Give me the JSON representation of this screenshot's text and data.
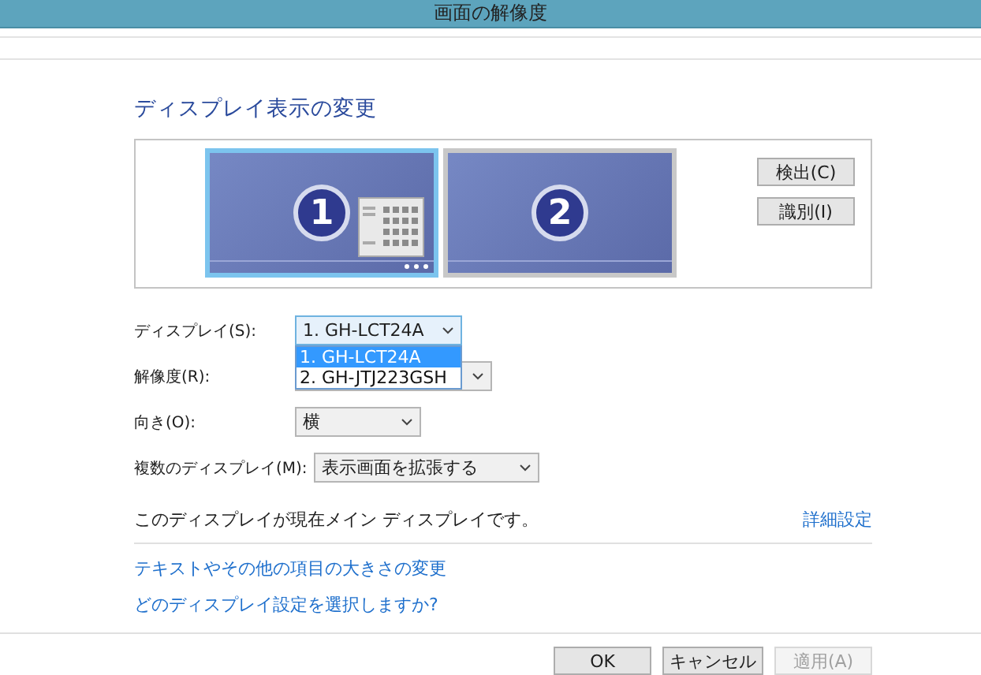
{
  "window": {
    "title": "画面の解像度"
  },
  "heading": "ディスプレイ表示の変更",
  "monitors": [
    {
      "number": "1",
      "selected": true,
      "main": true
    },
    {
      "number": "2",
      "selected": false,
      "main": false
    }
  ],
  "side_buttons": [
    "検出(C)",
    "識別(I)"
  ],
  "fields": [
    {
      "label": "ディスプレイ(S):",
      "value": "1. GH-LCT24A",
      "open": true,
      "options": [
        {
          "label": "1. GH-LCT24A",
          "selected": true
        },
        {
          "label": "2. GH-JTJ223GSH",
          "selected": false
        }
      ]
    },
    {
      "label": "解像度(R):",
      "open": false
    },
    {
      "label": "向き(O):",
      "value": "横",
      "open": false
    },
    {
      "label": "複数のディスプレイ(M):",
      "value": "表示画面を拡張する",
      "open": false
    }
  ],
  "main_note": "このディスプレイが現在メイン ディスプレイです。",
  "advanced_link": "詳細設定",
  "links": [
    "テキストやその他の項目の大きさの変更",
    "どのディスプレイ設定を選択しますか?"
  ],
  "buttons": [
    {
      "label": "OK",
      "disabled": false
    },
    {
      "label": "キャンセル",
      "disabled": false
    },
    {
      "label": "適用(A)",
      "disabled": true
    }
  ]
}
